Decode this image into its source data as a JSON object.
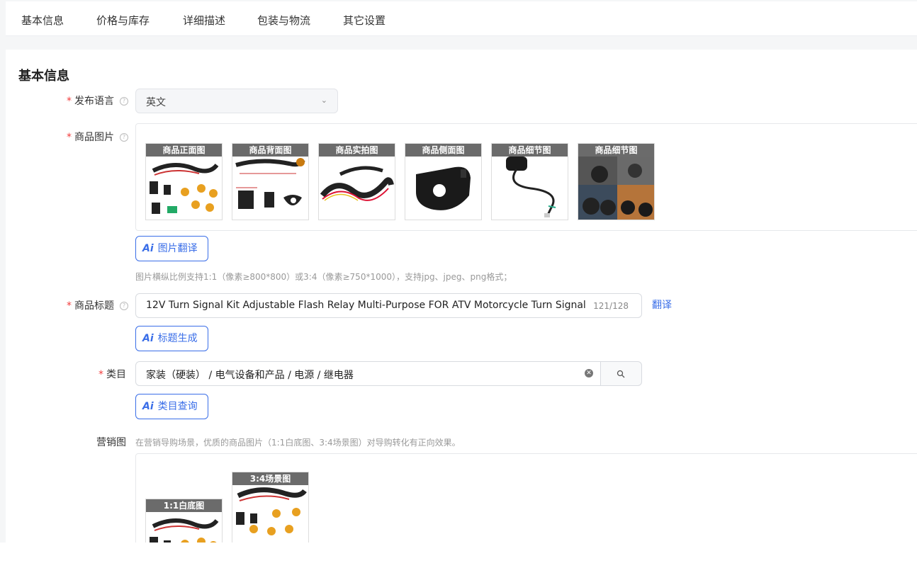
{
  "tabs": [
    "基本信息",
    "价格与库存",
    "详细描述",
    "包装与物流",
    "其它设置"
  ],
  "section_title": "基本信息",
  "language": {
    "label": "发布语言",
    "value": "英文"
  },
  "images": {
    "label": "商品图片",
    "captions": [
      "商品正面图",
      "商品背面图",
      "商品实拍图",
      "商品侧面图",
      "商品细节图",
      "商品细节图"
    ],
    "ai_button": "图片翻译",
    "hint": "图片横纵比例支持1:1（像素≥800*800）或3:4（像素≥750*1000），支持jpg、jpeg、png格式；"
  },
  "title": {
    "label": "商品标题",
    "value": "12V Turn Signal Kit Adjustable Flash Relay Multi-Purpose  FOR ATV  Motorcycle Turn Signal",
    "counter": "121/128",
    "translate_link": "翻译",
    "ai_button": "标题生成"
  },
  "category": {
    "label": "类目",
    "value": "家装（硬装） / 电气设备和产品 / 电源 / 继电器",
    "ai_button": "类目查询"
  },
  "marketing": {
    "label": "营销图",
    "hint": "在营销导购场景，优质的商品图片（1:1白底图、3:4场景图）对导购转化有正向效果。",
    "captions": [
      "1:1白底图",
      "3:4场景图"
    ]
  },
  "ai_mark": "Ai",
  "required_mark": "*",
  "colors": {
    "accent": "#3a6ee8",
    "required": "#f23c3c"
  }
}
